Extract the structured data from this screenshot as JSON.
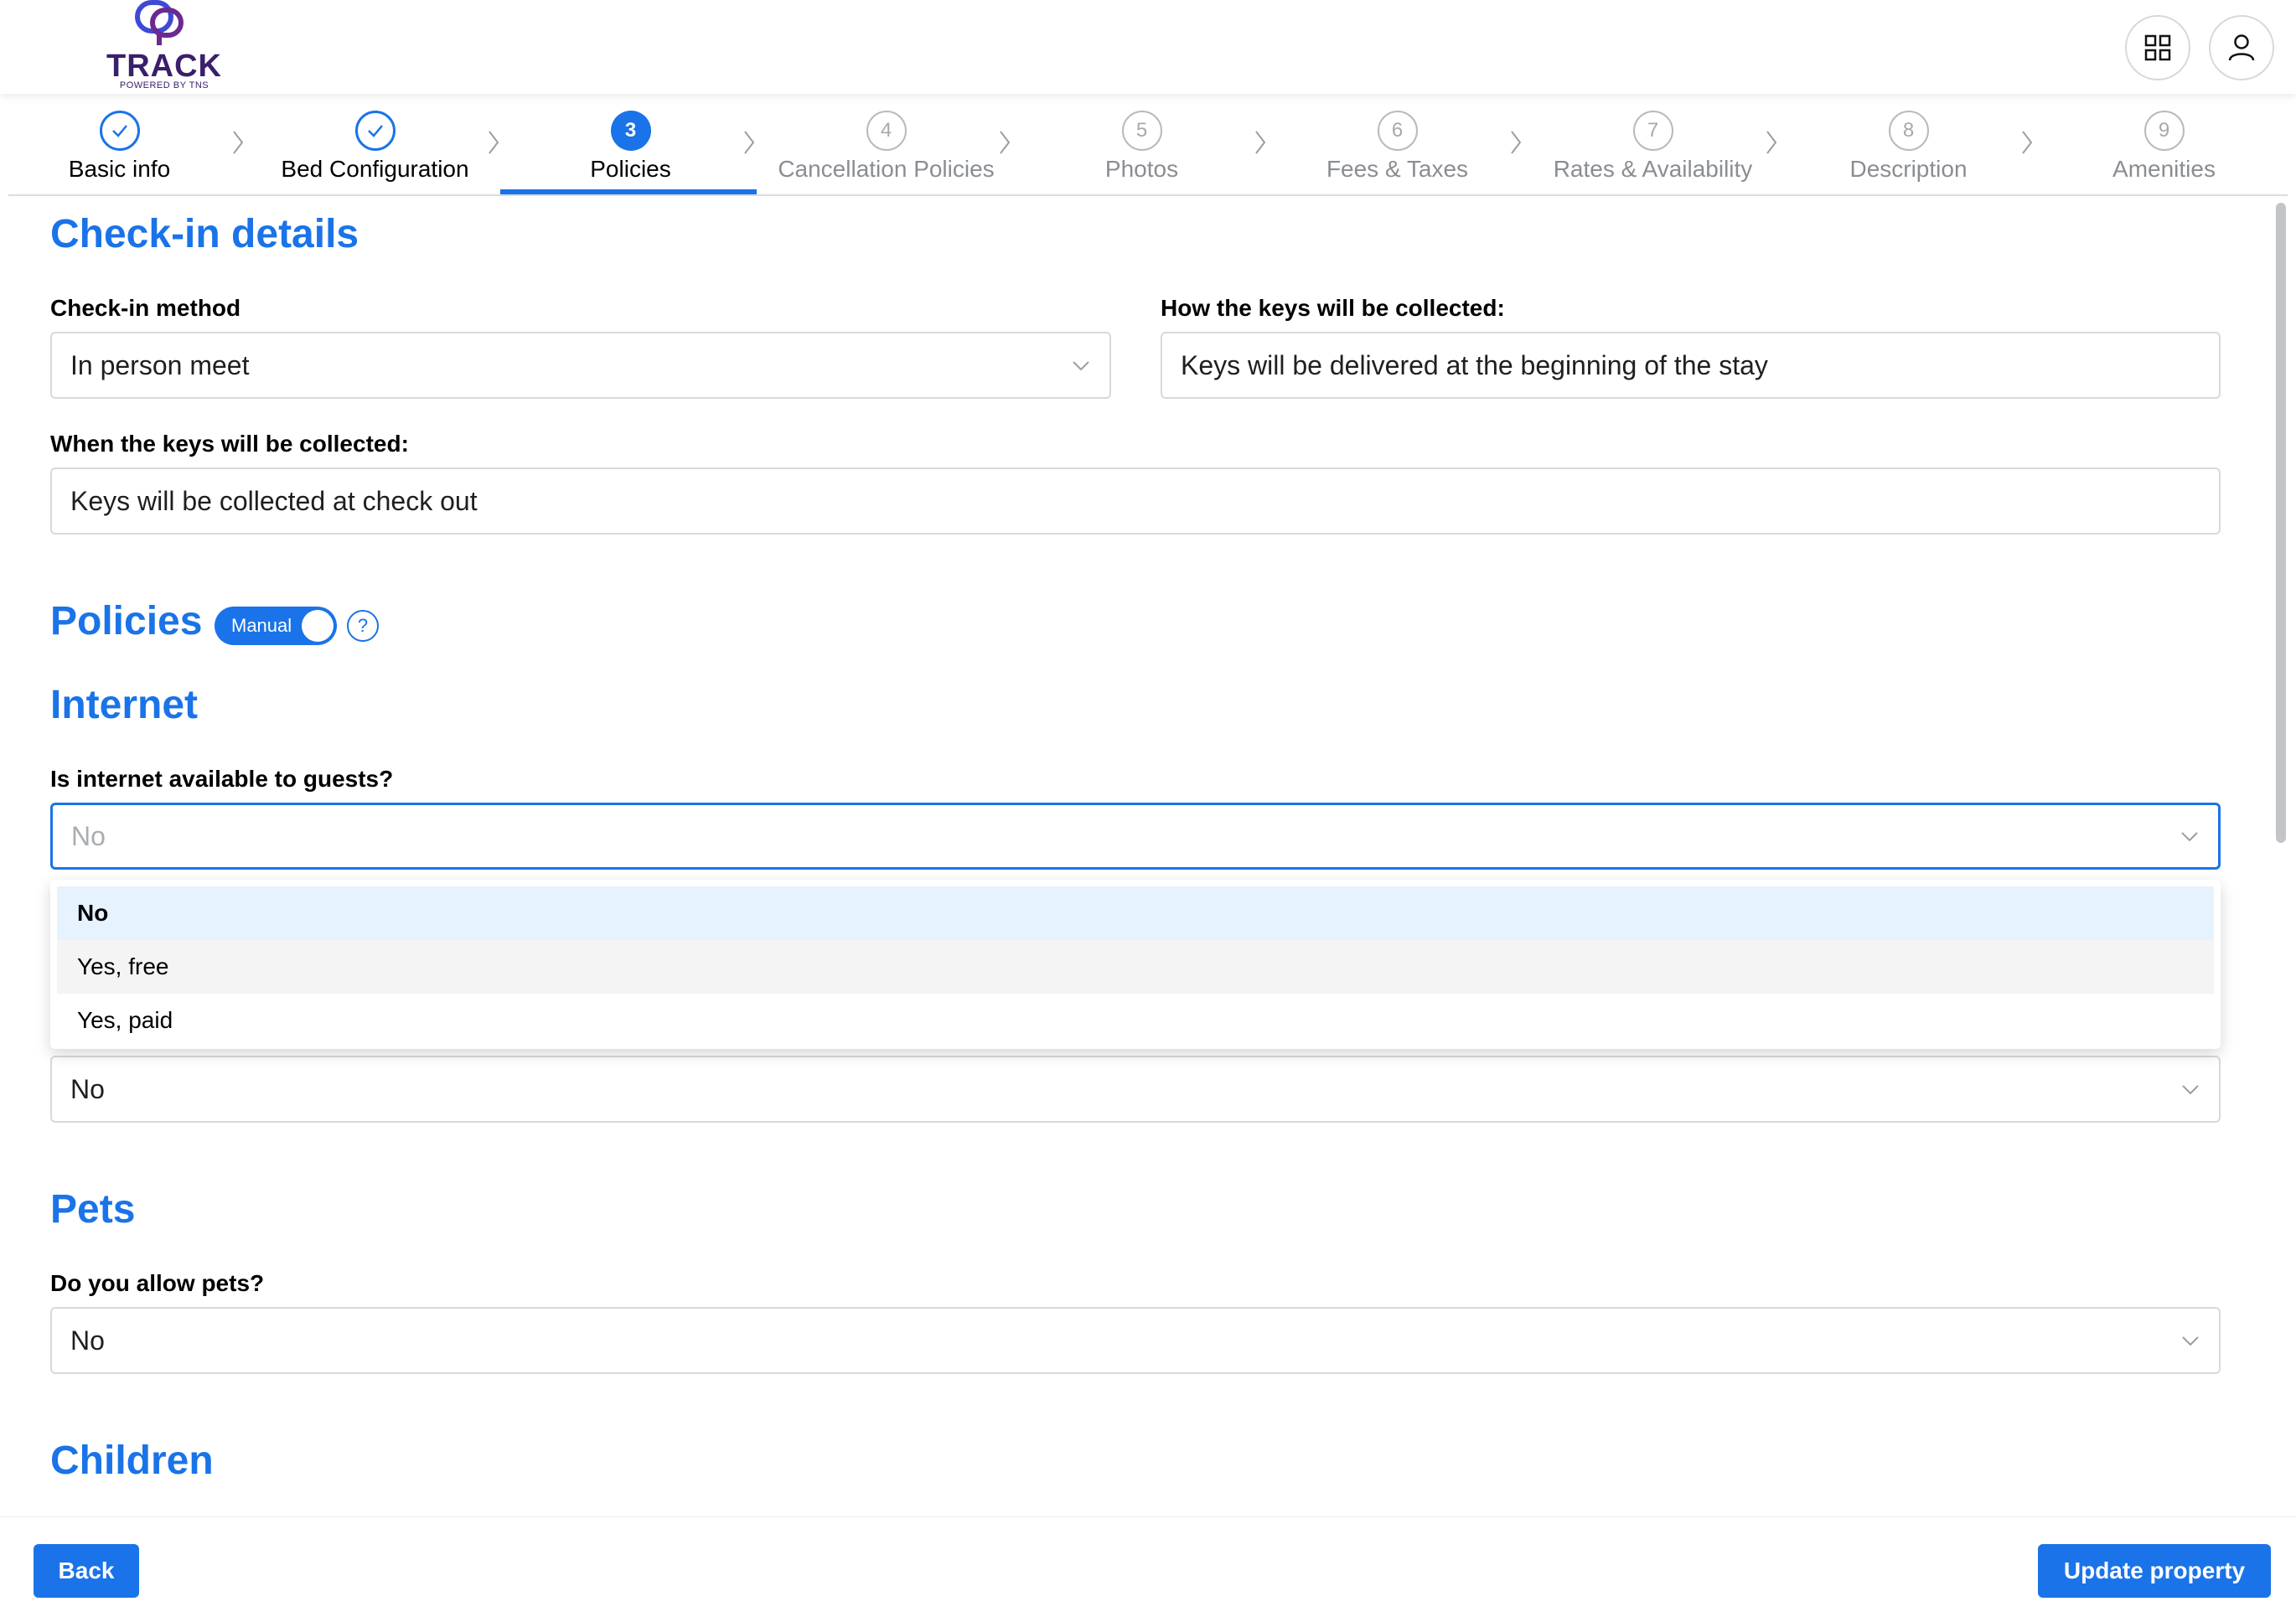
{
  "brand": {
    "name": "TRACK",
    "tagline": "POWERED BY TNS",
    "color": "#3a1f6b"
  },
  "header": {
    "apps_icon": "grid-icon",
    "user_icon": "user-icon"
  },
  "stepper": {
    "steps": [
      {
        "number": "1",
        "label": "Basic info",
        "state": "done"
      },
      {
        "number": "2",
        "label": "Bed Configuration",
        "state": "done"
      },
      {
        "number": "3",
        "label": "Policies",
        "state": "active"
      },
      {
        "number": "4",
        "label": "Cancellation Policies",
        "state": "todo"
      },
      {
        "number": "5",
        "label": "Photos",
        "state": "todo"
      },
      {
        "number": "6",
        "label": "Fees & Taxes",
        "state": "todo"
      },
      {
        "number": "7",
        "label": "Rates & Availability",
        "state": "todo"
      },
      {
        "number": "8",
        "label": "Description",
        "state": "todo"
      },
      {
        "number": "9",
        "label": "Amenities",
        "state": "todo"
      }
    ]
  },
  "checkin": {
    "title": "Check-in details",
    "method_label": "Check-in method",
    "method_value": "In person meet",
    "keys_how_label": "How the keys will be collected:",
    "keys_how_value": "Keys will be delivered at the beginning of the stay",
    "keys_when_label": "When the keys will be collected:",
    "keys_when_value": "Keys will be collected at check out"
  },
  "policies": {
    "title": "Policies",
    "toggle_label": "Manual",
    "help": "?"
  },
  "internet": {
    "title": "Internet",
    "question": "Is internet available to guests?",
    "placeholder": "No",
    "options": [
      "No",
      "Yes, free",
      "Yes, paid"
    ],
    "hidden_select_value": "No"
  },
  "pets": {
    "title": "Pets",
    "question": "Do you allow pets?",
    "value": "No"
  },
  "children": {
    "title": "Children"
  },
  "footer": {
    "back": "Back",
    "update": "Update property"
  },
  "colors": {
    "accent": "#1a73e8",
    "selected_option_bg": "#e6f2fe"
  }
}
